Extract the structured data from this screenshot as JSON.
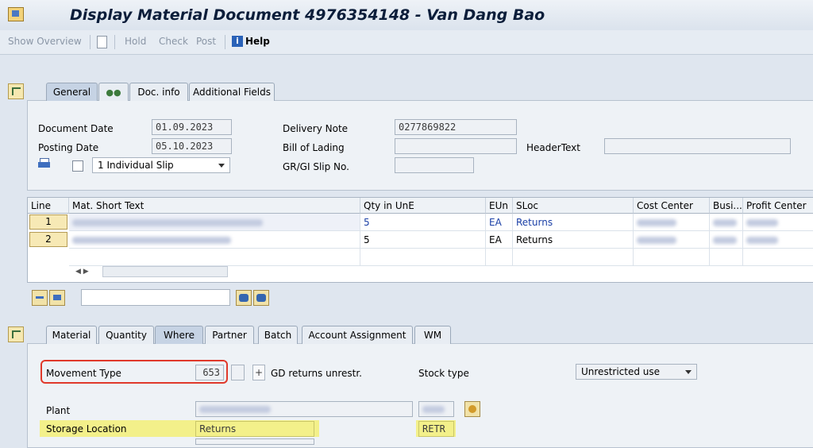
{
  "window": {
    "title": "Display Material Document 4976354148 - Van Dang Bao"
  },
  "toolbar": {
    "show_overview": "Show Overview",
    "hold": "Hold",
    "check": "Check",
    "post": "Post",
    "help": "Help"
  },
  "header_tabs": [
    "General",
    "Doc. info",
    "Additional Fields"
  ],
  "header": {
    "document_date_label": "Document Date",
    "document_date": "01.09.2023",
    "posting_date_label": "Posting Date",
    "posting_date": "05.10.2023",
    "slip_option": "1 Individual Slip",
    "delivery_note_label": "Delivery Note",
    "delivery_note": "0277869822",
    "bill_of_lading_label": "Bill of Lading",
    "bill_of_lading": "",
    "gr_gi_slip_label": "GR/GI Slip No.",
    "gr_gi_slip": "",
    "header_text_label": "HeaderText",
    "header_text": ""
  },
  "items_table": {
    "columns": [
      "Line",
      "Mat. Short Text",
      "Qty in UnE",
      "EUn",
      "SLoc",
      "Cost Center",
      "Busi...",
      "Profit Center"
    ],
    "rows": [
      {
        "line": "1",
        "qty": "5",
        "eun": "EA",
        "sloc": "Returns"
      },
      {
        "line": "2",
        "qty": "5",
        "eun": "EA",
        "sloc": "Returns"
      }
    ]
  },
  "item_tabs": [
    "Material",
    "Quantity",
    "Where",
    "Partner",
    "Batch",
    "Account Assignment",
    "WM"
  ],
  "where": {
    "movement_type_label": "Movement Type",
    "movement_type": "653",
    "plus": "+",
    "movement_desc": "GD returns unrestr.",
    "stock_type_label": "Stock type",
    "stock_type": "Unrestricted use",
    "plant_label": "Plant",
    "storage_location_label": "Storage Location",
    "storage_location": "Returns",
    "storage_code": "RETR"
  },
  "colors": {
    "highlight_red": "#e0392b",
    "highlight_yellow": "#f3f08a",
    "link_blue": "#1a3fa6"
  }
}
